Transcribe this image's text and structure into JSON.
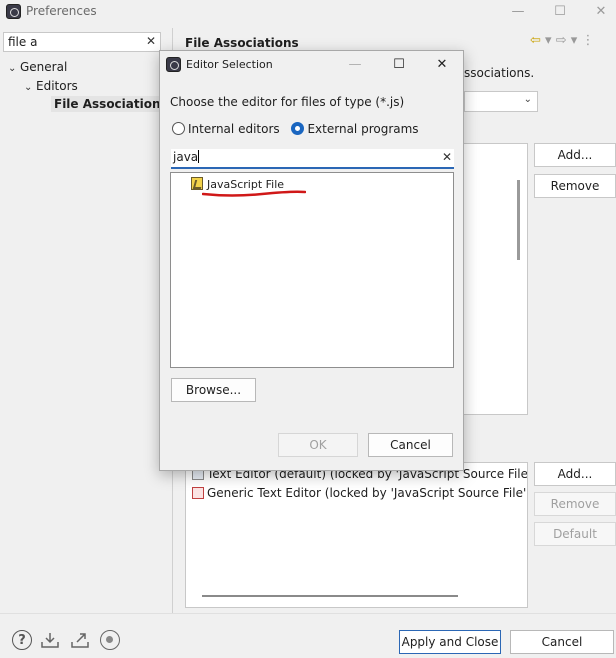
{
  "preferences": {
    "title": "Preferences",
    "window_buttons": {
      "minimize": "—",
      "maximize": "☐",
      "close": "✕"
    },
    "filter": {
      "value": "file a",
      "clear": "✕"
    },
    "tree": [
      {
        "label": "General",
        "arrow": "⌄"
      },
      {
        "label": "Editors",
        "arrow": "⌄"
      },
      {
        "label": "File Associations",
        "arrow": ""
      }
    ],
    "page_title": "File Associations",
    "nav": {
      "back": "⇦",
      "back_menu": "▾",
      "forward": "⇨",
      "forward_menu": "▾",
      "more": "⋮"
    },
    "description_tail": "ssociations.",
    "combo_arrow": "⌄",
    "file_types_buttons": {
      "add": "Add...",
      "remove": "Remove"
    },
    "associated_editors": [
      "Text Editor (default) (locked by 'JavaScript Source File' co",
      "Generic Text Editor (locked by 'JavaScript Source File' co"
    ],
    "editor_buttons": {
      "add": "Add...",
      "remove": "Remove",
      "default": "Default"
    },
    "bottom_buttons": {
      "apply_close": "Apply and Close",
      "cancel": "Cancel"
    },
    "bottom_icons": {
      "help": "?"
    }
  },
  "dialog": {
    "title": "Editor Selection",
    "window_buttons": {
      "minimize": "—",
      "maximize": "☐",
      "close": "✕"
    },
    "prompt": "Choose the editor for files of type (*.js)",
    "radio_internal": "Internal editors",
    "radio_external": "External programs",
    "search_value": "java",
    "search_clear": "✕",
    "list_items": [
      "JavaScript File"
    ],
    "browse": "Browse...",
    "ok": "OK",
    "cancel": "Cancel"
  },
  "colors": {
    "accent": "#2b67b5",
    "annotation": "#d01818",
    "nav_arrow": "#c9a000"
  }
}
